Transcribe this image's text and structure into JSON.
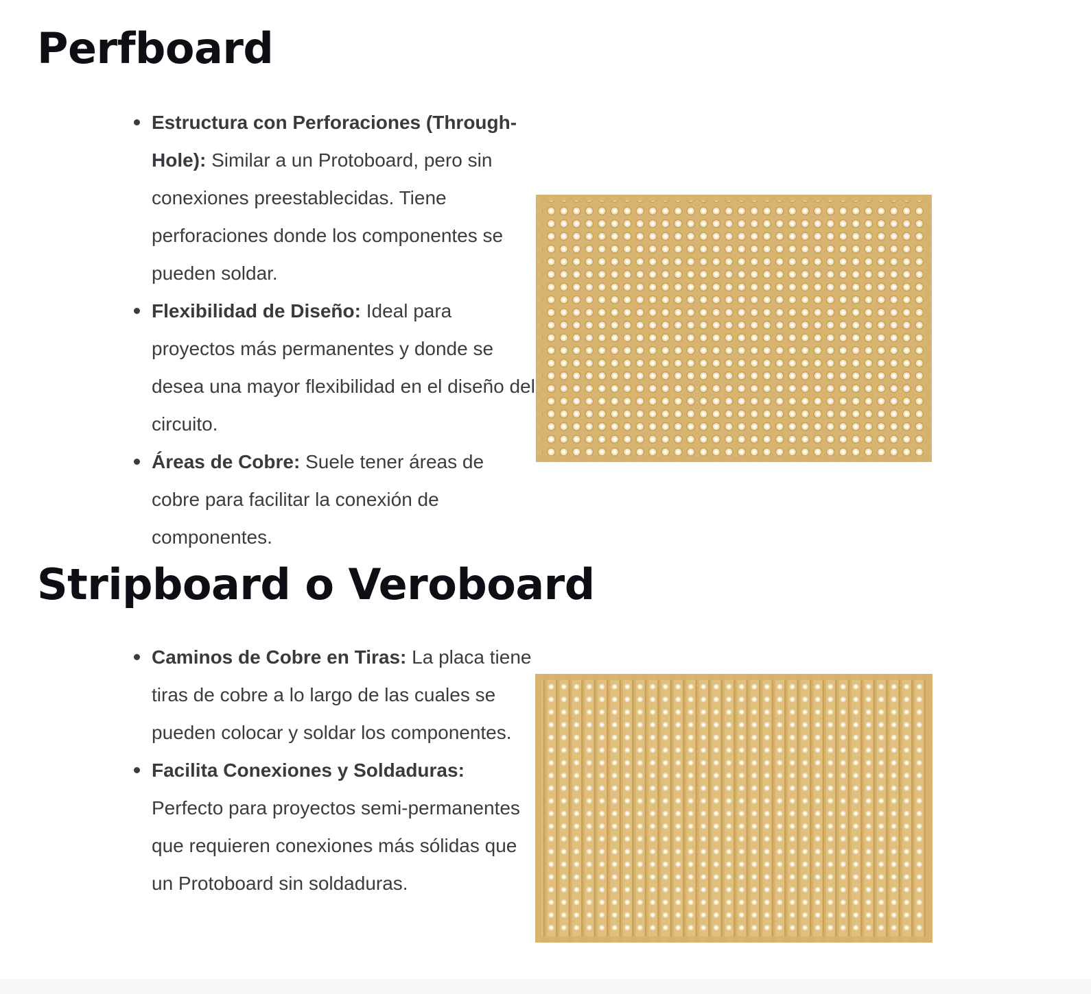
{
  "sections": [
    {
      "title": "Perfboard",
      "items": [
        {
          "term": "Estructura con Perforaciones (Through-Hole):",
          "text": " Similar a un Protoboard, pero sin conexiones preestablecidas. Tiene perforaciones donde los componentes se pueden soldar."
        },
        {
          "term": "Flexibilidad de Diseño:",
          "text": " Ideal para proyectos más permanentes y donde se desea una mayor flexibilidad en el diseño del circuito."
        },
        {
          "term": "Áreas de Cobre:",
          "text": " Suele tener áreas de cobre para facilitar la conexión de componentes."
        }
      ]
    },
    {
      "title": "Stripboard o Veroboard",
      "items": [
        {
          "term": "Caminos de Cobre en Tiras:",
          "text": " La placa tiene tiras de cobre a lo largo de las cuales se pueden colocar y soldar los componentes."
        },
        {
          "term": "Facilita Conexiones y Soldaduras:",
          "text": " Perfecto para proyectos semi-permanentes que requieren conexiones más sólidas que un Protoboard sin soldaduras."
        }
      ]
    }
  ],
  "colors": {
    "heading": "#0e0f14",
    "body_text": "#3c3c40",
    "board_copper": "#d7b470"
  }
}
